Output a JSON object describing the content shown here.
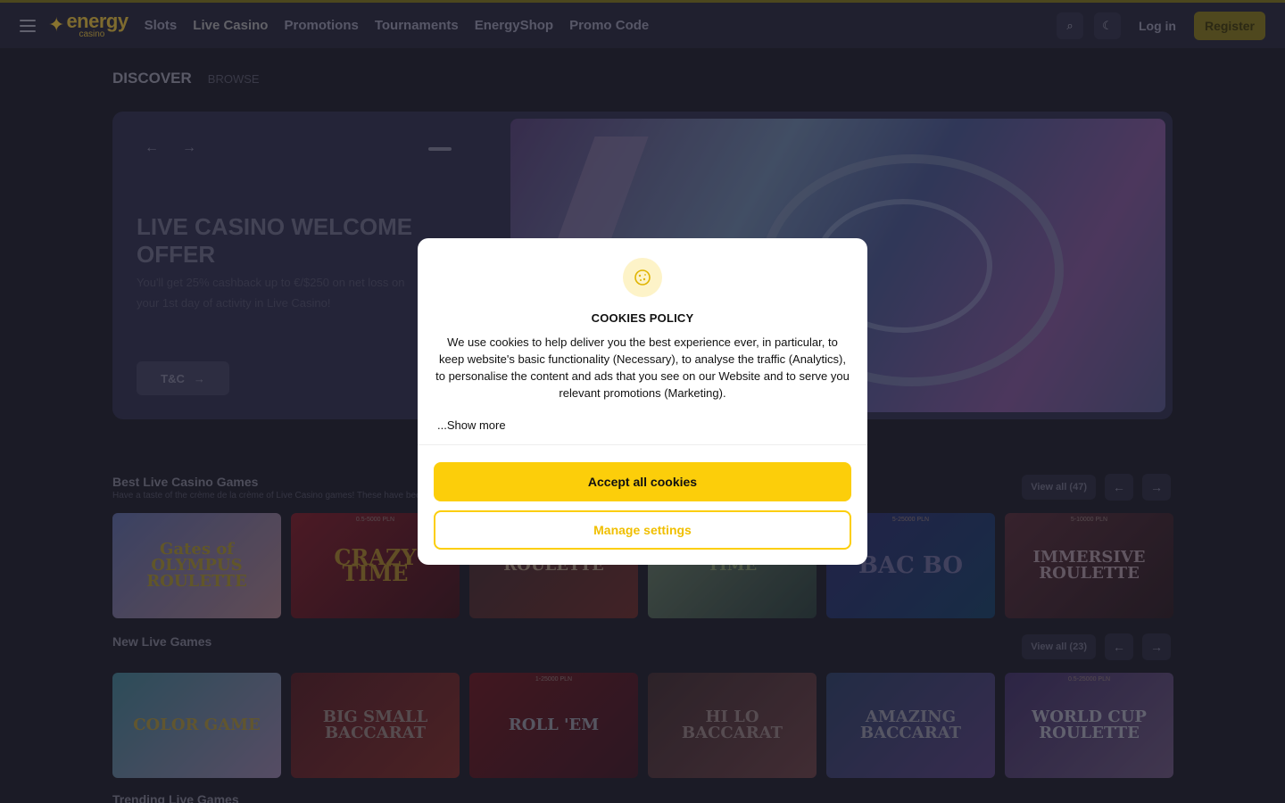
{
  "header": {
    "logo_main": "energy",
    "logo_sub": "casino",
    "nav": [
      "Slots",
      "Live Casino",
      "Promotions",
      "Tournaments",
      "EnergyShop",
      "Promo Code"
    ],
    "login_label": "Log in",
    "register_label": "Register"
  },
  "section_tabs": {
    "discover": "DISCOVER",
    "browse": "BROWSE"
  },
  "hero": {
    "title": "LIVE CASINO WELCOME OFFER",
    "subtitle": "You'll get 25% cashback up to €/$250 on net loss on your 1st day of activity in Live Casino!",
    "button_label": "T&C"
  },
  "rows": {
    "best": {
      "title": "Best Live Casino Games",
      "subtitle": "Have a taste of the crème de la crème of Live Casino games! These have been",
      "view_all": "View all (47)",
      "games": [
        {
          "name": "Gates of OLYMPUS ROULETTE",
          "meta": ""
        },
        {
          "name": "CRAZY TIME",
          "meta": "0.5-5000 PLN"
        },
        {
          "name": "ROULETTE",
          "meta": ""
        },
        {
          "name": "TIME",
          "meta": ""
        },
        {
          "name": "BAC BO",
          "meta": "5-25000 PLN"
        },
        {
          "name": "IMMERSIVE ROULETTE",
          "meta": "5-10000 PLN"
        }
      ]
    },
    "new": {
      "title": "New Live Games",
      "view_all": "View all (23)",
      "games": [
        {
          "name": "COLOR GAME",
          "meta": ""
        },
        {
          "name": "BIG SMALL BACCARAT",
          "meta": ""
        },
        {
          "name": "ROLL 'EM",
          "meta": "1-25000 PLN"
        },
        {
          "name": "HI LO BACCARAT",
          "meta": ""
        },
        {
          "name": "AMAZING BACCARAT",
          "meta": ""
        },
        {
          "name": "WORLD CUP ROULETTE",
          "meta": "0.5-25000 PLN"
        }
      ]
    },
    "trending": {
      "title": "Trending Live Games"
    }
  },
  "cookie_modal": {
    "title": "COOKIES POLICY",
    "text": "We use cookies to help deliver you the best experience ever, in particular, to keep website's basic functionality (Necessary), to analyse the traffic (Analytics), to personalise the content and ads that you see on our Website and to serve you relevant promotions (Marketing).",
    "show_more": "...Show more",
    "accept_label": "Accept all cookies",
    "manage_label": "Manage settings"
  },
  "colors": {
    "accent": "#fcce0a",
    "overlay": "#14141e",
    "modal_bg": "#ffffff"
  }
}
